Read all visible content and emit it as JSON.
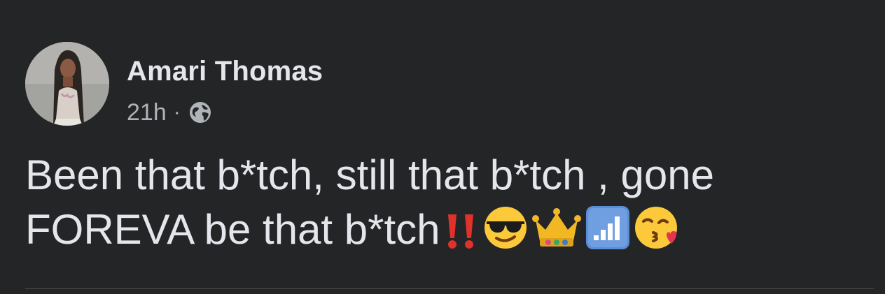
{
  "post": {
    "author": "Amari Thomas",
    "timestamp": "21h",
    "separator": "·",
    "audience_icon": "globe-icon",
    "text_line1": "Been that b*tch, still that b*tch , gone",
    "text_line2": "FOREVA be that b*tch",
    "emojis": [
      "double-exclamation-icon",
      "sunglasses-face-icon",
      "crown-icon",
      "signal-bars-icon",
      "kissing-face-icon"
    ]
  },
  "colors": {
    "background": "#242526",
    "primary_text": "#e4e6eb",
    "secondary_text": "#b0b3b8",
    "divider": "#4a4b4d"
  }
}
